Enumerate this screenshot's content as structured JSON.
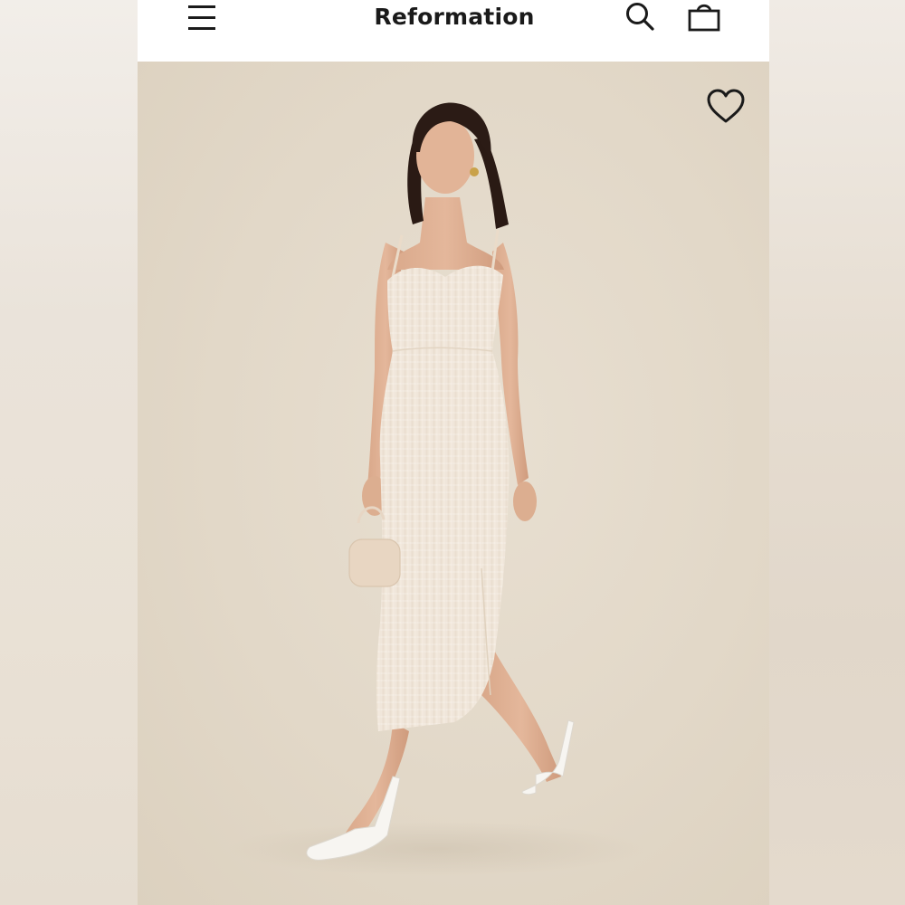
{
  "header": {
    "brand": "Reformation",
    "menu_icon": "hamburger-menu-icon",
    "search_icon": "search-icon",
    "bag_icon": "shopping-bag-icon"
  },
  "product_image": {
    "wishlist_icon": "heart-icon",
    "background_color": "#e2d8c8",
    "dress_color": "#f4ebe0",
    "shoe_color": "#f7f5f1"
  }
}
